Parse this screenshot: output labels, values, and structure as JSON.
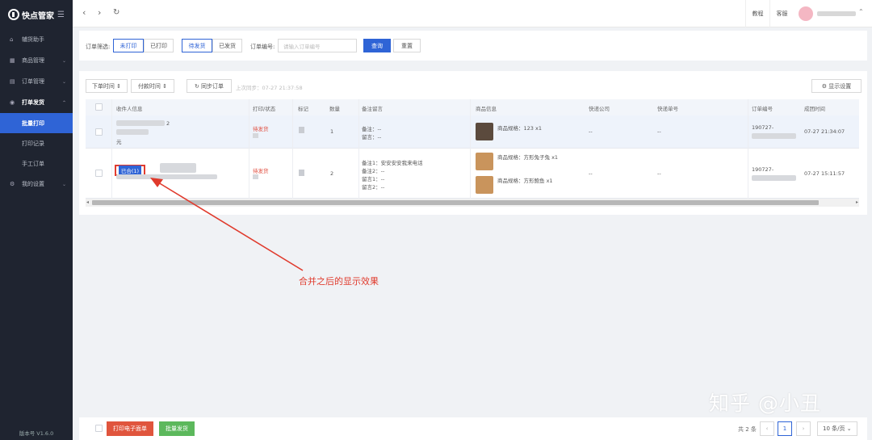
{
  "app": {
    "logo_text": "快点管家",
    "version": "版本号 V1.6.0"
  },
  "sidebar": {
    "items": [
      {
        "label": "辅货助手",
        "icon": "home-icon"
      },
      {
        "label": "商品管理",
        "icon": "grid-icon"
      },
      {
        "label": "订单管理",
        "icon": "order-icon"
      },
      {
        "label": "打单发货",
        "icon": "print-icon",
        "open": true
      },
      {
        "label": "批量打印",
        "sub": true,
        "active": true
      },
      {
        "label": "打印记录",
        "sub": true
      },
      {
        "label": "手工订单",
        "sub": true
      },
      {
        "label": "我的设置",
        "icon": "gear-icon"
      }
    ]
  },
  "topbar": {
    "help_label": "教程",
    "service_label": "客服"
  },
  "filter": {
    "order_filter_label": "订单筛选:",
    "print_options": [
      "未打印",
      "已打印"
    ],
    "ship_options": [
      "待发货",
      "已发货"
    ],
    "order_no_label": "订单编号:",
    "order_no_placeholder": "请输入订单编号",
    "query_label": "查询",
    "reset_label": "重置"
  },
  "toolbar": {
    "sort_order_time": "下单时间",
    "sort_pay_time": "付款时间",
    "sync_label": "同步订单",
    "last_sync": "上次同步：07-27 21:37:58",
    "display_settings": "显示设置"
  },
  "table": {
    "columns": [
      "收件人信息",
      "打印/状态",
      "标记",
      "数量",
      "备注留言",
      "商品信息",
      "快递公司",
      "快递单号",
      "订单编号",
      "成团时间"
    ],
    "rows": [
      {
        "recipient_tail": "2",
        "recipient_line2": "元",
        "status": "待发货",
        "qty": "1",
        "remarks": [
          "备注：--",
          "留言：--"
        ],
        "products": [
          {
            "label": "商品规格：123 x1"
          }
        ],
        "courier": "--",
        "tracking": "--",
        "order_no": "190727-",
        "group_time": "07-27 21:34:07"
      },
      {
        "merged_badge": "已合(1)",
        "status": "待发货",
        "qty": "2",
        "remarks": [
          "备注1：安安安安我来电话",
          "备注2：--",
          "留言1：--",
          "留言2：--"
        ],
        "products": [
          {
            "label": "商品规格：方形兔子兔 x1"
          },
          {
            "label": "商品规格：方形鲍鱼 x1"
          }
        ],
        "courier": "--",
        "tracking": "--",
        "order_no": "190727-",
        "group_time": "07-27 15:11:57"
      }
    ]
  },
  "annotation": "合并之后的显示效果",
  "bottom": {
    "print_waybill": "打印电子面单",
    "batch_ship": "批量发货",
    "total": "共 2 条",
    "current_page": "1",
    "page_size": "10 条/页"
  },
  "watermark": "知乎 @小丑",
  "colors": {
    "accent": "#2f64d6",
    "danger": "#e04b3c",
    "ship_green": "#5cb85c",
    "sidebar_bg": "#1f2430"
  }
}
